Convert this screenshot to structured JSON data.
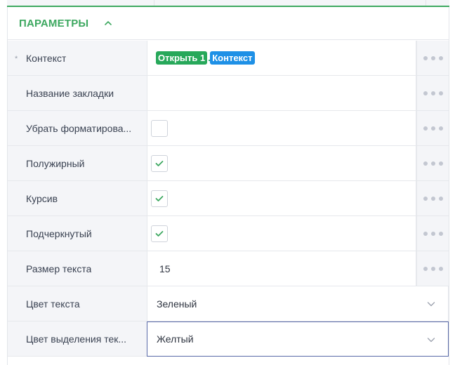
{
  "section": {
    "title": "ПАРАМЕТРЫ",
    "expanded": true,
    "accent_color": "#3da860"
  },
  "rows": [
    {
      "label": "Контекст",
      "required": true,
      "required_mark": "*",
      "type": "context",
      "chips": [
        {
          "text": "Открыть 1",
          "color": "#27a85a"
        },
        {
          "text": "Контекст",
          "color": "#1e90e6"
        }
      ],
      "chip_separator": "."
    },
    {
      "label": "Название закладки",
      "type": "text",
      "value": ""
    },
    {
      "label": "Убрать форматирование",
      "label_display": "Убрать форматирова...",
      "type": "checkbox",
      "checked": false
    },
    {
      "label": "Полужирный",
      "type": "checkbox",
      "checked": true
    },
    {
      "label": "Курсив",
      "type": "checkbox",
      "checked": true
    },
    {
      "label": "Подчеркнутый",
      "type": "checkbox",
      "checked": true
    },
    {
      "label": "Размер текста",
      "type": "number",
      "value": "15"
    },
    {
      "label": "Цвет текста",
      "type": "select",
      "value": "Зеленый"
    },
    {
      "label": "Цвет выделения текста",
      "label_display": "Цвет выделения тек...",
      "type": "select",
      "value": "Желтый",
      "focused": true
    }
  ],
  "icons": {
    "collapse": "chevron-up-icon",
    "menu": "more-dots-icon",
    "check": "checkmark-icon",
    "dropdown": "chevron-down-icon"
  },
  "colors": {
    "check": "#3da860",
    "focus_border": "#5a6aa8",
    "label_bg": "#f4f5f8"
  }
}
